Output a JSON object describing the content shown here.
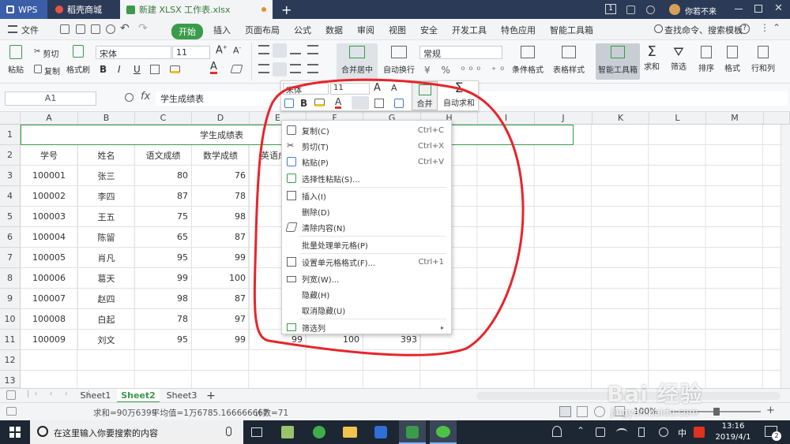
{
  "tabs": {
    "wps": "WPS",
    "shop": "稻壳商城",
    "file": "新建 XLSX 工作表.xlsx",
    "new_tab": "+"
  },
  "titlebar": {
    "page_badge": "1",
    "username": "你若不来"
  },
  "menu": {
    "file": "文件",
    "items": [
      "开始",
      "插入",
      "页面布局",
      "公式",
      "数据",
      "审阅",
      "视图",
      "安全",
      "开发工具",
      "特色应用",
      "智能工具箱"
    ],
    "search": "查找命令、搜索模板"
  },
  "ribbon": {
    "paste": "粘贴",
    "cut": "剪切",
    "copy": "复制",
    "format_painter": "格式刷",
    "font": "宋体",
    "size": "11",
    "bold": "B",
    "italic": "I",
    "underline": "U",
    "font_color": "A",
    "merge": "合并居中",
    "wrap": "自动换行",
    "number_format": "常规",
    "cond_format": "条件格式",
    "table_style": "表格样式",
    "smart_tools": "智能工具箱",
    "sum": "求和",
    "filter": "筛选",
    "sort": "排序",
    "format": "格式",
    "row_col": "行和列"
  },
  "formula": {
    "cell_ref": "A1",
    "fx": "fx",
    "content": "学生成绩表"
  },
  "columns": [
    "A",
    "B",
    "C",
    "D",
    "E",
    "F",
    "G",
    "H",
    "I",
    "J",
    "K",
    "L",
    "M"
  ],
  "rows": [
    "1",
    "2",
    "3",
    "4",
    "5",
    "6",
    "7",
    "8",
    "9",
    "10",
    "11",
    "12",
    "13"
  ],
  "table": {
    "title": "学生成绩表",
    "headers": [
      "学号",
      "姓名",
      "语文成绩",
      "数学成绩",
      "英语成"
    ],
    "records": [
      [
        "100001",
        "张三",
        "80",
        "76"
      ],
      [
        "100002",
        "李四",
        "87",
        "78"
      ],
      [
        "100003",
        "王五",
        "75",
        "98"
      ],
      [
        "100004",
        "陈留",
        "65",
        "87"
      ],
      [
        "100005",
        "肖凡",
        "95",
        "99"
      ],
      [
        "100006",
        "葛天",
        "99",
        "100"
      ],
      [
        "100007",
        "赵四",
        "98",
        "87"
      ],
      [
        "100008",
        "白起",
        "78",
        "97"
      ],
      [
        "100009",
        "刘文",
        "95",
        "99"
      ]
    ],
    "row11_extra": [
      "99",
      "100",
      "393"
    ]
  },
  "minitoolbar": {
    "font": "宋体",
    "size": "11",
    "grow": "A",
    "shrink": "A",
    "bold": "B",
    "font_color": "A",
    "merge": "合并",
    "autosum": "自动求和"
  },
  "context_menu": [
    {
      "label": "复制(C)",
      "shortcut": "Ctrl+C"
    },
    {
      "label": "剪切(T)",
      "shortcut": "Ctrl+X"
    },
    {
      "label": "粘贴(P)",
      "shortcut": "Ctrl+V"
    },
    {
      "label": "选择性粘贴(S)...",
      "shortcut": ""
    },
    {
      "label": "插入(I)",
      "shortcut": ""
    },
    {
      "label": "删除(D)",
      "shortcut": ""
    },
    {
      "label": "清除内容(N)",
      "shortcut": ""
    },
    {
      "label": "批量处理单元格(P)",
      "shortcut": ""
    },
    {
      "label": "设置单元格格式(F)...",
      "shortcut": "Ctrl+1"
    },
    {
      "label": "列宽(W)...",
      "shortcut": ""
    },
    {
      "label": "隐藏(H)",
      "shortcut": ""
    },
    {
      "label": "取消隐藏(U)",
      "shortcut": ""
    },
    {
      "label": "筛选列",
      "shortcut": ""
    }
  ],
  "sheets": [
    "Sheet1",
    "Sheet2",
    "Sheet3"
  ],
  "status": {
    "sum": "求和=90万6399",
    "avg": "平均值=1万6785.166666667",
    "count": "计数=71",
    "zoom": "100%"
  },
  "taskbar": {
    "search": "在这里输入你要搜索的内容",
    "ime": "中",
    "time": "13:16",
    "date": "2019/4/1",
    "notif": "2"
  },
  "watermark": {
    "text": "Bai  经验",
    "url": "jingyan.baidu.com"
  },
  "colors": {
    "accent": "#3a9b4a",
    "titlebar": "#2b3b57",
    "annotation": "#e8242b"
  }
}
